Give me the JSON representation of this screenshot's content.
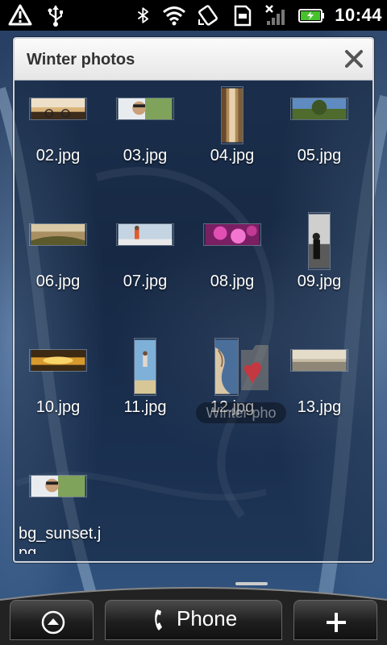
{
  "status_bar": {
    "time": "10:44",
    "icons": [
      "alert-icon",
      "usb-icon",
      "bluetooth-icon",
      "wifi-icon",
      "rotate-icon",
      "sd-card-icon",
      "signal-icon",
      "battery-icon"
    ]
  },
  "widget": {
    "title": "Winter photos",
    "close_icon": "close-icon",
    "ghost_label": "Winter pho",
    "photos": [
      {
        "name": "02.jpg"
      },
      {
        "name": "03.jpg"
      },
      {
        "name": "04.jpg"
      },
      {
        "name": "05.jpg"
      },
      {
        "name": "06.jpg"
      },
      {
        "name": "07.jpg"
      },
      {
        "name": "08.jpg"
      },
      {
        "name": "09.jpg"
      },
      {
        "name": "10.jpg"
      },
      {
        "name": "11.jpg"
      },
      {
        "name": "12.jpg"
      },
      {
        "name": "13.jpg"
      },
      {
        "name": "bg_sunset.jpg"
      }
    ]
  },
  "dock": {
    "left_icon": "chevron-up-icon",
    "center_label": "Phone",
    "center_icon": "phone-icon",
    "right_icon": "plus-icon"
  }
}
